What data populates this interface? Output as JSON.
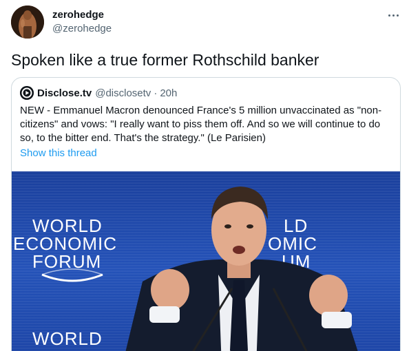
{
  "author": {
    "display_name": "zerohedge",
    "handle": "@zerohedge",
    "avatar_icon": "avatar-photo"
  },
  "tweet": {
    "text": "Spoken like a true former Rothschild banker",
    "more_icon": "more-dots-icon"
  },
  "quote": {
    "name": "Disclose.tv",
    "handle": "@disclosetv",
    "separator": "·",
    "time": "20h",
    "text_lines": [
      "NEW - Emmanuel Macron denounced France's 5 million unvaccinated as \"non-",
      "citizens\" and vows: \"I really want to piss them off. And so we will continue to do",
      "so, to the bitter end. That's the strategy.\" (Le Parisien)"
    ],
    "show_thread": "Show this thread",
    "logo_icon": "play-circle-icon"
  },
  "media": {
    "banner_lines_left": [
      "WORLD",
      "ECONOMIC",
      "FORUM"
    ],
    "banner_lines_right": [
      "LD",
      "OMIC",
      "UM"
    ],
    "banner_bottom_left": [
      "WORLD"
    ],
    "colors": {
      "background": "#1f48aa",
      "text": "#ffffff",
      "link": "#1d9bf0"
    }
  }
}
